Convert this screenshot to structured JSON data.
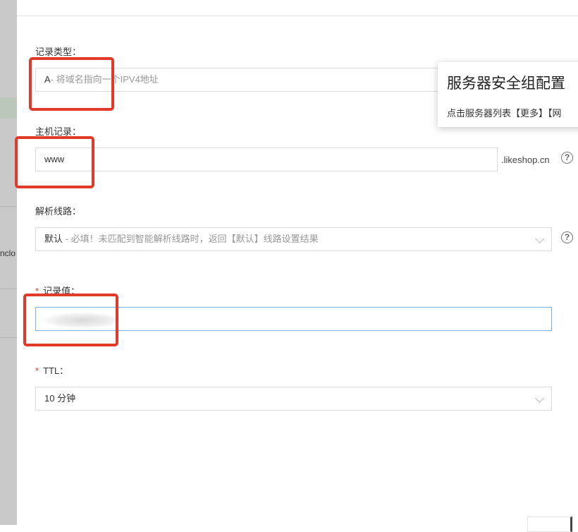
{
  "backdrop": {
    "fragment_text": "nclo"
  },
  "form": {
    "record_type": {
      "label": "记录类型：",
      "value_prefix": "A",
      "value_hint": "- 将域名指向一个IPV4地址"
    },
    "host_record": {
      "label": "主机记录：",
      "value": "www",
      "suffix": ".likeshop.cn"
    },
    "resolve_line": {
      "label": "解析线路：",
      "value_prefix": "默认",
      "value_hint": " - 必填！未匹配到智能解析线路时，返回【默认】线路设置结果"
    },
    "record_value": {
      "required_mark": "*",
      "label": "记录值："
    },
    "ttl": {
      "required_mark": "*",
      "label": "TTL：",
      "value": "10 分钟"
    },
    "help_glyph": "?"
  },
  "tooltip": {
    "title": "服务器安全组配置",
    "body": "点击服务器列表【更多】【网"
  },
  "colors": {
    "callout_border": "#e23a2a",
    "focus_border": "#7ab3e8",
    "required_mark": "#e03b2b"
  }
}
